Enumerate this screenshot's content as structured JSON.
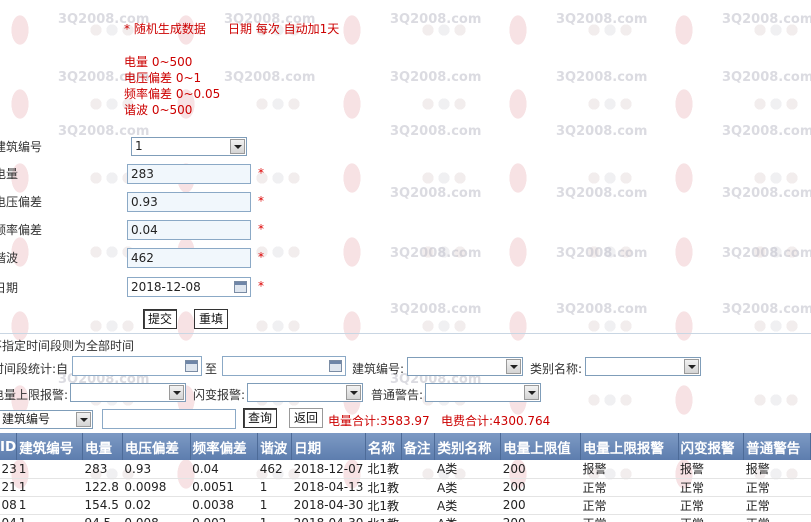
{
  "watermark": "3Q2008.com",
  "info": {
    "line1": "* 随机生成数据",
    "line1b": "日期  每次  自动加1天",
    "ranges": [
      "电量 0~500",
      "电压偏差 0~1",
      "频率偏差 0~0.05",
      "谐波 0~500"
    ]
  },
  "form": {
    "building_label": "建筑编号",
    "building_value": "1",
    "power_label": "电量",
    "power_value": "283",
    "voltage_label": "电压偏差",
    "voltage_value": "0.93",
    "freq_label": "频率偏差",
    "freq_value": "0.04",
    "harmonic_label": "谐波",
    "harmonic_value": "462",
    "date_label": "日期",
    "date_value": "2018-12-08",
    "required_mark": "*",
    "submit_label": "提交",
    "reset_label": "重填"
  },
  "filter": {
    "hint": "不指定时间段则为全部时间",
    "period_label": "时间段统计:自",
    "to_label": "至",
    "building_label": "建筑编号:",
    "category_label": "类别名称:",
    "upper_alarm_label": "电量上限报警:",
    "flash_alarm_label": "闪变报警:",
    "normal_alarm_label": "普通警告:",
    "search_field_value": "建筑编号",
    "query_label": "查询",
    "back_label": "返回",
    "power_total": "电量合计:3583.97",
    "fee_total": "电费合计:4300.764"
  },
  "table": {
    "columns": [
      "ID",
      "建筑编号",
      "电量",
      "电压偏差",
      "频率偏差",
      "谐波",
      "日期",
      "名称",
      "备注",
      "类别名称",
      "电量上限值",
      "电量上限报警",
      "闪变报警",
      "普通警告"
    ],
    "rows": [
      [
        "23",
        "1",
        "283",
        "0.93",
        "0.04",
        "462",
        "2018-12-07",
        "北1教",
        "",
        "A类",
        "200",
        "报警",
        "报警",
        "报警"
      ],
      [
        "21",
        "1",
        "122.8",
        "0.0098",
        "0.0051",
        "1",
        "2018-04-13",
        "北1教",
        "",
        "A类",
        "200",
        "正常",
        "正常",
        "正常"
      ],
      [
        "08",
        "1",
        "154.5",
        "0.02",
        "0.0038",
        "1",
        "2018-04-30",
        "北1教",
        "",
        "A类",
        "200",
        "正常",
        "正常",
        "正常"
      ],
      [
        "04",
        "1",
        "94.5",
        "0.008",
        "0.002",
        "1",
        "2018-04-30",
        "北1教",
        "",
        "A类",
        "200",
        "正常",
        "正常",
        "正常"
      ]
    ]
  }
}
